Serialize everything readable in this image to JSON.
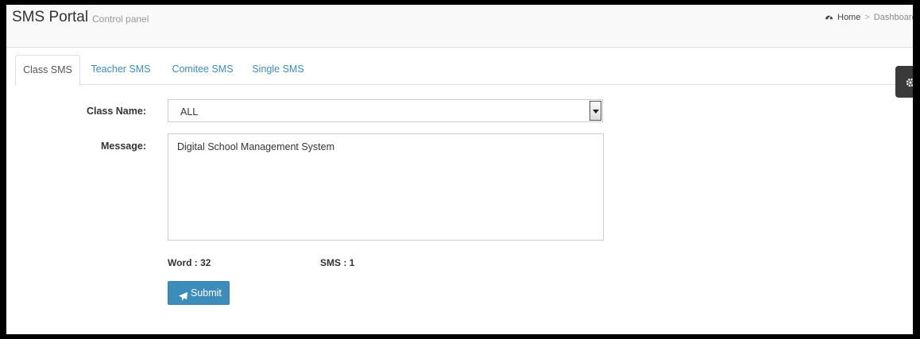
{
  "header": {
    "title": "SMS Portal",
    "subtitle": "Control panel",
    "breadcrumb": [
      "Home",
      "Dashboard"
    ]
  },
  "tabs": [
    {
      "label": "Class SMS",
      "active": true
    },
    {
      "label": "Teacher SMS",
      "active": false
    },
    {
      "label": "Comitee SMS",
      "active": false
    },
    {
      "label": "Single SMS",
      "active": false
    }
  ],
  "form": {
    "class_label": "Class Name:",
    "class_value": "ALL",
    "message_label": "Message:",
    "message_value": "Digital School Management System",
    "word_count": "Word : 32",
    "sms_count": "SMS : 1",
    "submit_label": "Submit"
  },
  "icons": {
    "breadcrumb": "dashboard-icon",
    "submit": "paper-plane-icon",
    "settings": "gear-icon"
  },
  "colors": {
    "accent": "#3c8dbc",
    "header_bg": "#f9f9f9",
    "settings_tab": "#3a3a3a"
  }
}
